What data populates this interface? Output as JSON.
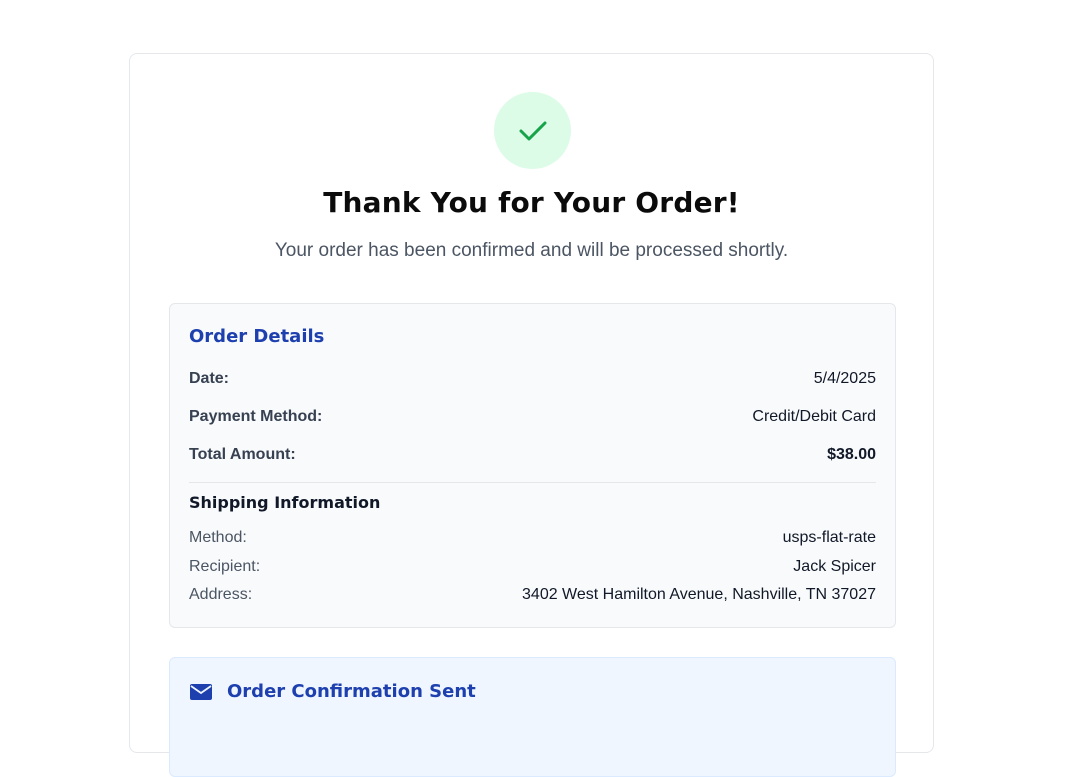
{
  "header": {
    "title": "Thank You for Your Order!",
    "subtitle": "Your order has been confirmed and will be processed shortly."
  },
  "order_details": {
    "title": "Order Details",
    "date_label": "Date:",
    "date_value": "5/4/2025",
    "payment_label": "Payment Method:",
    "payment_value": "Credit/Debit Card",
    "total_label": "Total Amount:",
    "total_value": "$38.00"
  },
  "shipping": {
    "title": "Shipping Information",
    "method_label": "Method:",
    "method_value": "usps-flat-rate",
    "recipient_label": "Recipient:",
    "recipient_value": "Jack Spicer",
    "address_label": "Address:",
    "address_value": "3402 West Hamilton Avenue, Nashville, TN 37027"
  },
  "confirmation": {
    "title": "Order Confirmation Sent"
  },
  "icons": {
    "success": "check-icon",
    "email": "envelope-icon"
  },
  "colors": {
    "success_green": "#16a34a",
    "success_bg": "#dcfce7",
    "accent_blue": "#1e40af"
  }
}
